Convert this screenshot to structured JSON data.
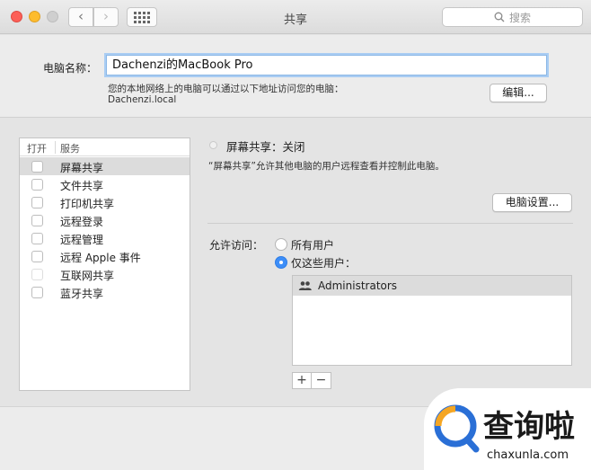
{
  "window": {
    "title": "共享",
    "search_placeholder": "搜索",
    "back_glyph": "‹",
    "forward_glyph": "›"
  },
  "computer": {
    "name_label": "电脑名称：",
    "name_value": "Dachenzi的MacBook Pro",
    "address_line1": "您的本地网络上的电脑可以通过以下地址访问您的电脑：",
    "address_line2": "Dachenzi.local",
    "edit_button": "编辑..."
  },
  "services": {
    "header_open": "打开",
    "header_service": "服务",
    "items": [
      {
        "label": "屏幕共享",
        "checked": false,
        "selected": true
      },
      {
        "label": "文件共享",
        "checked": false,
        "selected": false
      },
      {
        "label": "打印机共享",
        "checked": false,
        "selected": false
      },
      {
        "label": "远程登录",
        "checked": false,
        "selected": false
      },
      {
        "label": "远程管理",
        "checked": false,
        "selected": false
      },
      {
        "label": "远程 Apple 事件",
        "checked": false,
        "selected": false
      },
      {
        "label": "互联网共享",
        "checked": false,
        "selected": false
      },
      {
        "label": "蓝牙共享",
        "checked": false,
        "selected": false
      }
    ]
  },
  "detail": {
    "status_title": "屏幕共享：关闭",
    "status_description": "“屏幕共享”允许其他电脑的用户远程查看并控制此电脑。",
    "computer_settings_button": "电脑设置...",
    "access_label": "允许访问：",
    "option_all": "所有用户",
    "option_only": "仅这些用户：",
    "selected_option": "only",
    "users": [
      "Administrators"
    ],
    "add_glyph": "+",
    "remove_glyph": "−"
  },
  "watermark": {
    "brand": "查询啦",
    "domain": "chaxunla.com"
  },
  "colors": {
    "accent": "#3d8ef8",
    "watermark_blue": "#2a6fd6",
    "watermark_orange": "#f5a623"
  },
  "icons": {
    "search": "magnifier-icon",
    "grid": "grid-icon",
    "group": "group-users-icon"
  }
}
